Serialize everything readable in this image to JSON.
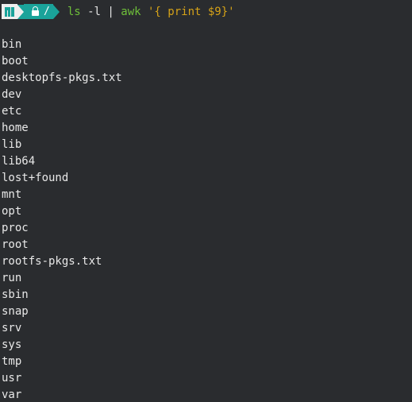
{
  "prompt": {
    "logo_icon": "manjaro-logo-icon",
    "lock_icon": "lock-icon",
    "directory": "/",
    "command": {
      "program": "ls",
      "args": " -l ",
      "pipe": "|",
      "filter": "awk",
      "filter_arg": " '{ print $9}'"
    }
  },
  "output": [
    "bin",
    "boot",
    "desktopfs-pkgs.txt",
    "dev",
    "etc",
    "home",
    "lib",
    "lib64",
    "lost+found",
    "mnt",
    "opt",
    "proc",
    "root",
    "rootfs-pkgs.txt",
    "run",
    "sbin",
    "snap",
    "srv",
    "sys",
    "tmp",
    "usr",
    "var"
  ],
  "colors": {
    "background": "#2a2c2f",
    "segment_teal": "#1aa39a",
    "command_green": "#6fbf3a",
    "string_yellow": "#d5a218"
  }
}
